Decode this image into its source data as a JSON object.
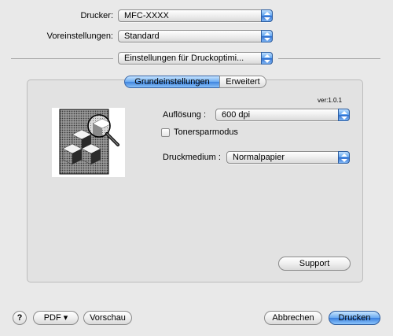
{
  "printer": {
    "label": "Drucker:",
    "value": "MFC-XXXX"
  },
  "presets": {
    "label": "Voreinstellungen:",
    "value": "Standard"
  },
  "panel_select": {
    "value": "Einstellungen für Druckoptimi..."
  },
  "tabs": [
    {
      "label": "Grundeinstellungen",
      "selected": true
    },
    {
      "label": "Erweitert",
      "selected": false
    }
  ],
  "version": "ver:1.0.1",
  "resolution": {
    "label": "Auflösung :",
    "value": "600 dpi"
  },
  "toner_save": {
    "label": "Tonersparmodus",
    "checked": false
  },
  "media": {
    "label": "Druckmedium :",
    "value": "Normalpapier"
  },
  "support_button": "Support",
  "footer": {
    "help": "?",
    "pdf": "PDF ▾",
    "preview": "Vorschau",
    "cancel": "Abbrechen",
    "print": "Drucken"
  },
  "icons": {
    "popup_arrows": "up-down-arrows-icon",
    "preview": "print-preview-icon",
    "magnifier": "magnifier-icon"
  },
  "colors": {
    "accent": "#4f8fe6",
    "window_bg": "#e9e9e9"
  }
}
